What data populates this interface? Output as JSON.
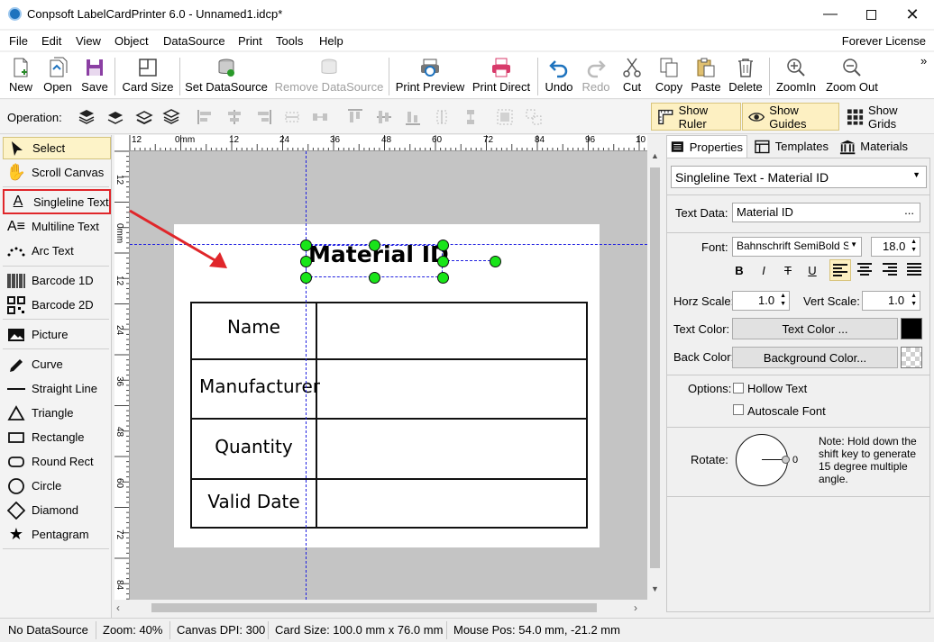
{
  "app": {
    "title": "Conpsoft LabelCardPrinter 6.0 - Unnamed1.idcp*"
  },
  "menu": {
    "items": [
      "File",
      "Edit",
      "View",
      "Object",
      "DataSource",
      "Print",
      "Tools",
      "Help"
    ],
    "license": "Forever License"
  },
  "toolbar": {
    "new": "New",
    "open": "Open",
    "save": "Save",
    "card_size": "Card Size",
    "set_ds": "Set DataSource",
    "remove_ds": "Remove DataSource",
    "print_preview": "Print Preview",
    "print_direct": "Print Direct",
    "undo": "Undo",
    "redo": "Redo",
    "cut": "Cut",
    "copy": "Copy",
    "paste": "Paste",
    "delete": "Delete",
    "zoom_in": "ZoomIn",
    "zoom_out": "Zoom Out"
  },
  "opbar": {
    "label": "Operation:",
    "show_ruler": "Show Ruler",
    "show_guides": "Show Guides",
    "show_grids": "Show Grids"
  },
  "tools": {
    "select": "Select",
    "scroll": "Scroll Canvas",
    "singleline": "Singleline Text",
    "multiline": "Multiline Text",
    "arc": "Arc Text",
    "barcode1d": "Barcode 1D",
    "barcode2d": "Barcode 2D",
    "picture": "Picture",
    "curve": "Curve",
    "line": "Straight Line",
    "triangle": "Triangle",
    "rectangle": "Rectangle",
    "roundrect": "Round Rect",
    "circle": "Circle",
    "diamond": "Diamond",
    "pentagram": "Pentagram"
  },
  "ruler": {
    "h_labels": [
      "12",
      "0mm",
      "12",
      "24",
      "36",
      "48",
      "60",
      "72",
      "84",
      "96",
      "10"
    ],
    "v_labels": [
      "12",
      "0mm",
      "12",
      "24",
      "36",
      "48",
      "60",
      "72",
      "84"
    ]
  },
  "label": {
    "title": "Material ID",
    "rows": [
      "Name",
      "Manufacturer",
      "Quantity",
      "Valid Date"
    ]
  },
  "status": {
    "datasource": "No DataSource",
    "zoom": "Zoom: 40%",
    "dpi": "Canvas DPI: 300",
    "card": "Card Size: 100.0 mm x 76.0 mm",
    "mouse": "Mouse Pos: 54.0 mm, -21.2 mm"
  },
  "props": {
    "tabs": [
      "Properties",
      "Templates",
      "Materials"
    ],
    "object": "Singleline Text - Material ID",
    "text_data_label": "Text Data:",
    "text_data": "Material ID",
    "ellipsis": "...",
    "font_label": "Font:",
    "font": "Bahnschrift SemiBold S",
    "font_size": "18.0",
    "fmt": [
      "B",
      "I",
      "T",
      "U"
    ],
    "horz_label": "Horz Scale:",
    "horz": "1.0",
    "vert_label": "Vert Scale:",
    "vert": "1.0",
    "text_color_label": "Text Color:",
    "text_color_btn": "Text Color ...",
    "back_color_label": "Back Color:",
    "back_color_btn": "Background Color...",
    "options_label": "Options:",
    "hollow": "Hollow Text",
    "autoscale": "Autoscale Font",
    "rotate_label": "Rotate:",
    "rotate_value": "0",
    "note": "Note: Hold down the shift key to generate 15 degree multiple angle.",
    "text_color": "#000000"
  },
  "colors": {
    "accent": "#1e73be",
    "highlight": "#e0262a",
    "handle": "#19e519",
    "guide": "#2020e0"
  }
}
